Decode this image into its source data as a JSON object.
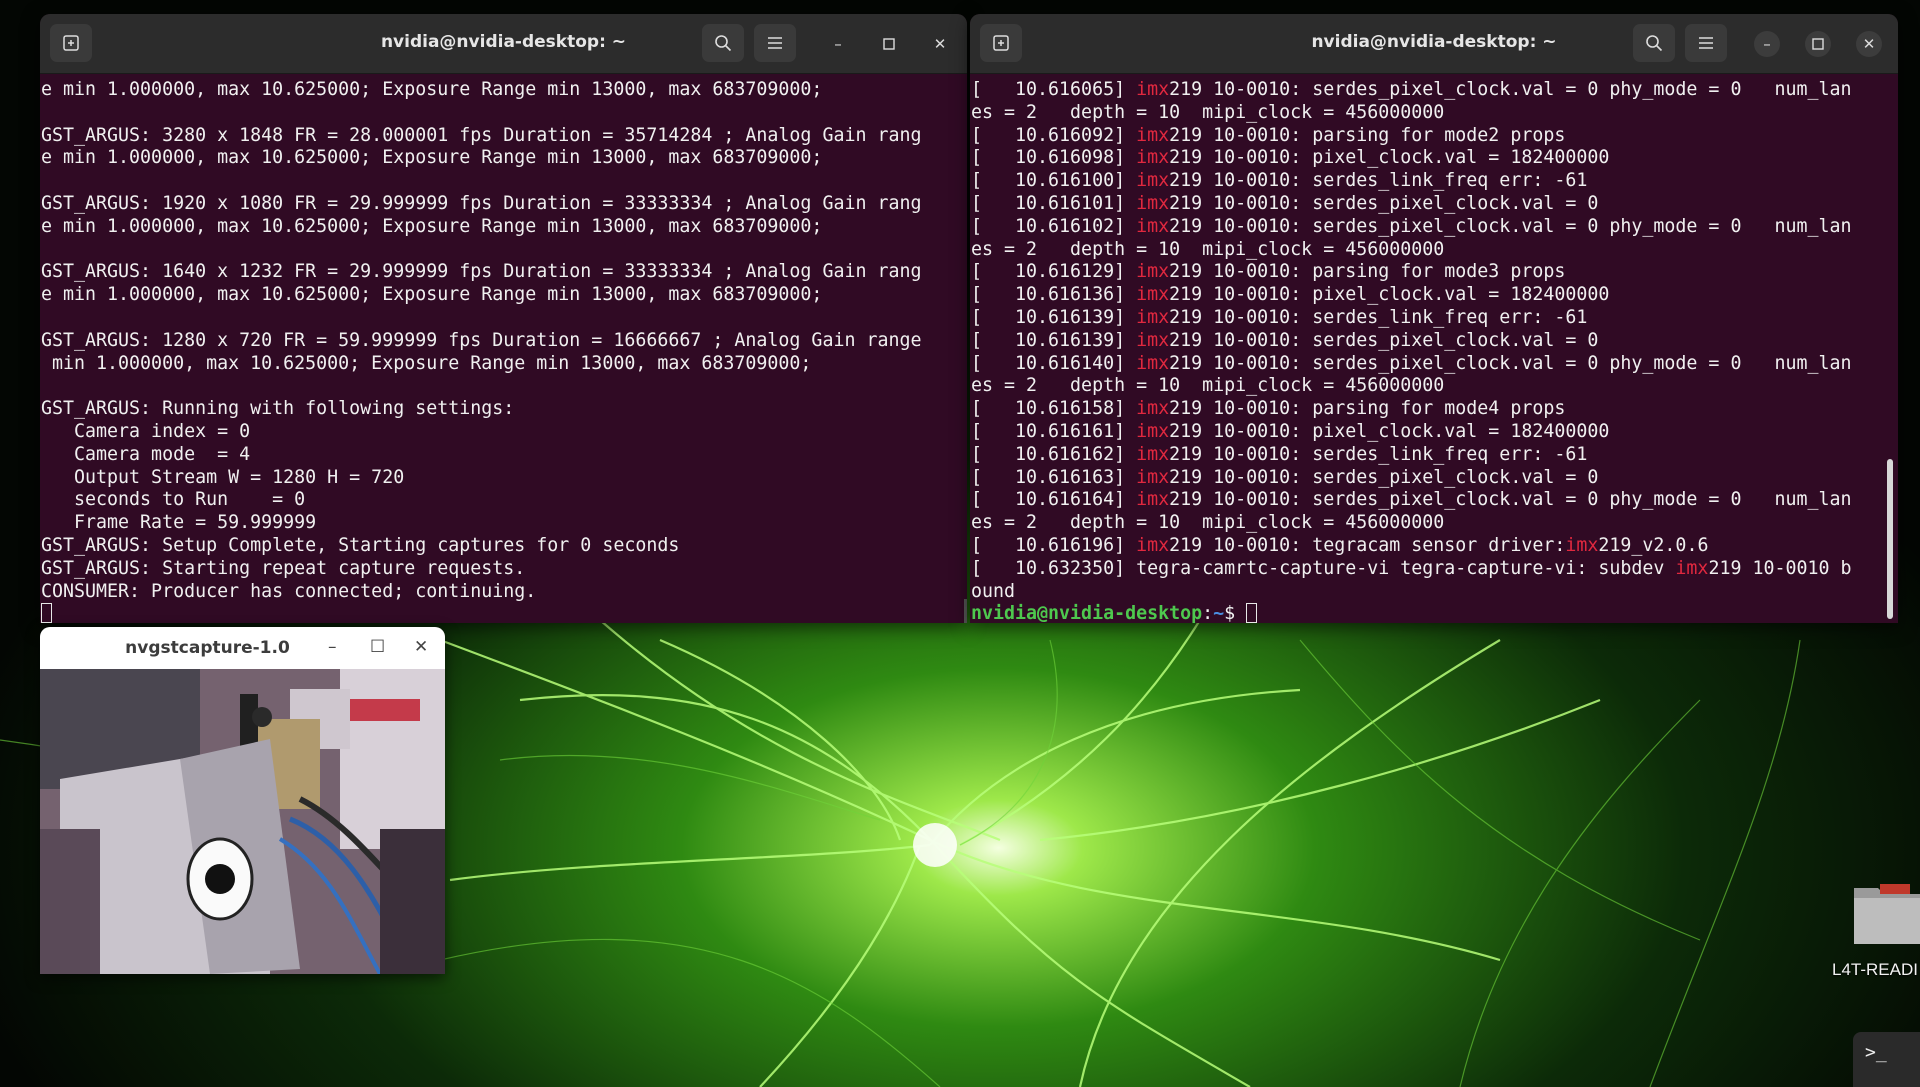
{
  "left_terminal": {
    "title": "nvidia@nvidia-desktop: ~",
    "lines": [
      "e min 1.000000, max 10.625000; Exposure Range min 13000, max 683709000;",
      "",
      "GST_ARGUS: 3280 x 1848 FR = 28.000001 fps Duration = 35714284 ; Analog Gain rang",
      "e min 1.000000, max 10.625000; Exposure Range min 13000, max 683709000;",
      "",
      "GST_ARGUS: 1920 x 1080 FR = 29.999999 fps Duration = 33333334 ; Analog Gain rang",
      "e min 1.000000, max 10.625000; Exposure Range min 13000, max 683709000;",
      "",
      "GST_ARGUS: 1640 x 1232 FR = 29.999999 fps Duration = 33333334 ; Analog Gain rang",
      "e min 1.000000, max 10.625000; Exposure Range min 13000, max 683709000;",
      "",
      "GST_ARGUS: 1280 x 720 FR = 59.999999 fps Duration = 16666667 ; Analog Gain range",
      " min 1.000000, max 10.625000; Exposure Range min 13000, max 683709000;",
      "",
      "GST_ARGUS: Running with following settings:",
      "   Camera index = 0",
      "   Camera mode  = 4",
      "   Output Stream W = 1280 H = 720",
      "   seconds to Run    = 0",
      "   Frame Rate = 59.999999",
      "GST_ARGUS: Setup Complete, Starting captures for 0 seconds",
      "GST_ARGUS: Starting repeat capture requests.",
      "CONSUMER: Producer has connected; continuing."
    ]
  },
  "right_terminal": {
    "title": "nvidia@nvidia-desktop: ~",
    "lines": [
      {
        "pre": "[   10.616065] ",
        "red": "imx",
        "post": "219 10-0010: serdes_pixel_clock.val = 0 phy_mode = 0   num_lan"
      },
      {
        "pre": "es = 2   depth = 10  mipi_clock = 456000000",
        "red": "",
        "post": ""
      },
      {
        "pre": "[   10.616092] ",
        "red": "imx",
        "post": "219 10-0010: parsing for mode2 props"
      },
      {
        "pre": "[   10.616098] ",
        "red": "imx",
        "post": "219 10-0010: pixel_clock.val = 182400000"
      },
      {
        "pre": "[   10.616100] ",
        "red": "imx",
        "post": "219 10-0010: serdes_link_freq err: -61"
      },
      {
        "pre": "[   10.616101] ",
        "red": "imx",
        "post": "219 10-0010: serdes_pixel_clock.val = 0"
      },
      {
        "pre": "[   10.616102] ",
        "red": "imx",
        "post": "219 10-0010: serdes_pixel_clock.val = 0 phy_mode = 0   num_lan"
      },
      {
        "pre": "es = 2   depth = 10  mipi_clock = 456000000",
        "red": "",
        "post": ""
      },
      {
        "pre": "[   10.616129] ",
        "red": "imx",
        "post": "219 10-0010: parsing for mode3 props"
      },
      {
        "pre": "[   10.616136] ",
        "red": "imx",
        "post": "219 10-0010: pixel_clock.val = 182400000"
      },
      {
        "pre": "[   10.616139] ",
        "red": "imx",
        "post": "219 10-0010: serdes_link_freq err: -61"
      },
      {
        "pre": "[   10.616139] ",
        "red": "imx",
        "post": "219 10-0010: serdes_pixel_clock.val = 0"
      },
      {
        "pre": "[   10.616140] ",
        "red": "imx",
        "post": "219 10-0010: serdes_pixel_clock.val = 0 phy_mode = 0   num_lan"
      },
      {
        "pre": "es = 2   depth = 10  mipi_clock = 456000000",
        "red": "",
        "post": ""
      },
      {
        "pre": "[   10.616158] ",
        "red": "imx",
        "post": "219 10-0010: parsing for mode4 props"
      },
      {
        "pre": "[   10.616161] ",
        "red": "imx",
        "post": "219 10-0010: pixel_clock.val = 182400000"
      },
      {
        "pre": "[   10.616162] ",
        "red": "imx",
        "post": "219 10-0010: serdes_link_freq err: -61"
      },
      {
        "pre": "[   10.616163] ",
        "red": "imx",
        "post": "219 10-0010: serdes_pixel_clock.val = 0"
      },
      {
        "pre": "[   10.616164] ",
        "red": "imx",
        "post": "219 10-0010: serdes_pixel_clock.val = 0 phy_mode = 0   num_lan"
      },
      {
        "pre": "es = 2   depth = 10  mipi_clock = 456000000",
        "red": "",
        "post": ""
      },
      {
        "pre": "[   10.616196] ",
        "red": "imx",
        "post": "219 10-0010: tegracam sensor driver:",
        "red2": "imx",
        "post2": "219_v2.0.6"
      },
      {
        "pre": "[   10.632350] tegra-camrtc-capture-vi tegra-capture-vi: subdev ",
        "red": "imx",
        "post": "219 10-0010 b"
      },
      {
        "pre": "ound",
        "red": "",
        "post": ""
      }
    ],
    "prompt_user": "nvidia@nvidia-desktop",
    "prompt_sep": ":",
    "prompt_path": "~",
    "prompt_symbol": "$ "
  },
  "capture_window": {
    "title": "nvgstcapture-1.0",
    "minimize": "–",
    "maximize": "☐",
    "close": "✕"
  },
  "desktop": {
    "folder_label": "L4T-READI",
    "dock_terminal_glyph": ">_"
  },
  "icons": {
    "new_tab": "new-tab-icon",
    "search": "search-icon",
    "menu": "hamburger-menu-icon",
    "minimize": "minimize-icon",
    "maximize": "maximize-icon",
    "close": "close-icon"
  },
  "colors": {
    "terminal_bg": "#300a24",
    "titlebar_bg": "#2c2c2c",
    "highlight_red": "#e0283f",
    "prompt_green": "#4ec84e",
    "prompt_blue": "#4a8ee0"
  }
}
